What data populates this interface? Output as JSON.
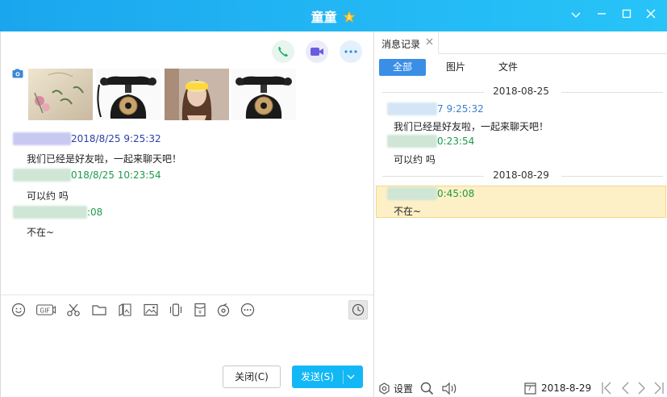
{
  "window": {
    "title": "童童",
    "title_badge_icon": "star-badge-icon",
    "accent_color": "#1aa6ee"
  },
  "chat": {
    "messages": [
      {
        "time_suffix": "2018/8/25 9:25:32",
        "text": "我们已经是好友啦，一起来聊天吧！",
        "color": "#2a3fa8"
      },
      {
        "time_suffix": "018/8/25 10:23:54",
        "text": "可以约 吗",
        "color": "#1c9a4a"
      },
      {
        "time_suffix": ":08",
        "text": "不在~",
        "color": "#1c9a4a"
      }
    ],
    "buttons": {
      "close": "关闭(C)",
      "send": "发送(S)"
    },
    "toolbar_icons": [
      "smile-icon",
      "gif-icon",
      "scissors-icon",
      "folder-icon",
      "image-search-icon",
      "picture-icon",
      "shake-icon",
      "red-packet-icon",
      "music-icon",
      "more-icon"
    ]
  },
  "history": {
    "tab_label": "消息记录",
    "filters": [
      "全部",
      "图片",
      "文件"
    ],
    "groups": [
      {
        "date": "2018-08-25",
        "entries": [
          {
            "time_suffix": "7 9:25:32",
            "text": "我们已经是好友啦，一起来聊天吧！",
            "color": "#3a7fd0"
          },
          {
            "time_suffix": "0:23:54",
            "text": "可以约 吗",
            "color": "#1c9a4a"
          }
        ]
      },
      {
        "date": "2018-08-29",
        "entries": [
          {
            "time_suffix": "0:45:08",
            "text": "不在~",
            "color": "#1c9a4a"
          }
        ]
      }
    ],
    "bottom": {
      "settings_label": "设置",
      "calendar_day": "7",
      "current_date": "2018-8-29"
    }
  }
}
